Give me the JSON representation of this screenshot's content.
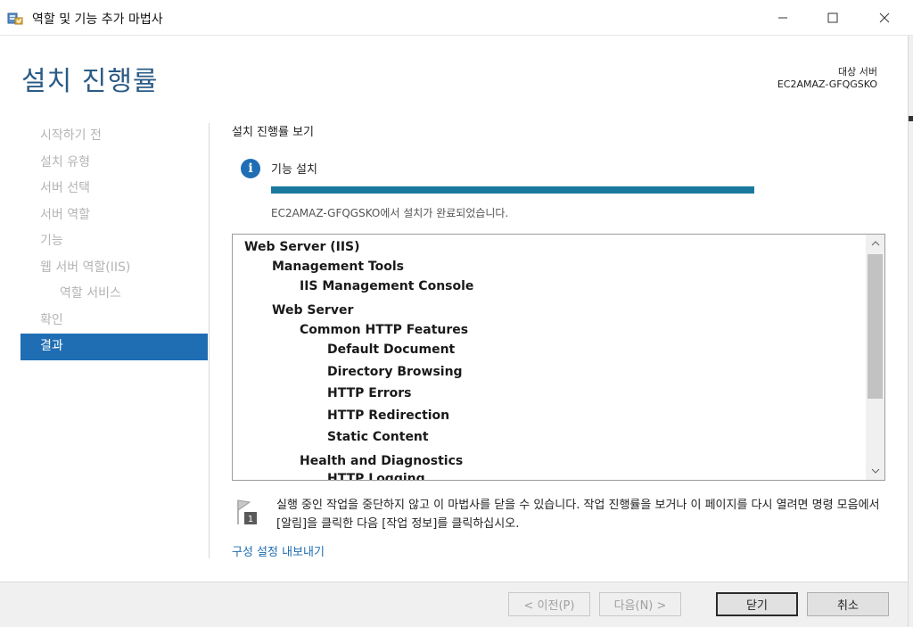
{
  "window": {
    "title": "역할 및 기능 추가 마법사",
    "icon": "server-manager-icon"
  },
  "header": {
    "page_title": "설치 진행률",
    "target_label": "대상 서버",
    "target_name": "EC2AMAZ-GFQGSKO"
  },
  "nav": {
    "items": [
      {
        "label": "시작하기 전",
        "state": "disabled"
      },
      {
        "label": "설치 유형",
        "state": "disabled"
      },
      {
        "label": "서버 선택",
        "state": "disabled"
      },
      {
        "label": "서버 역할",
        "state": "disabled"
      },
      {
        "label": "기능",
        "state": "disabled"
      },
      {
        "label": "웹 서버 역할(IIS)",
        "state": "disabled"
      },
      {
        "label": "역할 서비스",
        "state": "disabled"
      },
      {
        "label": "확인",
        "state": "disabled"
      },
      {
        "label": "결과",
        "state": "active"
      }
    ]
  },
  "main": {
    "section_title": "설치 진행률 보기",
    "feature_label": "기능 설치",
    "progress_percent": 100,
    "status_text": "EC2AMAZ-GFQGSKO에서 설치가 완료되었습니다.",
    "results": [
      {
        "label": "Web Server (IIS)",
        "level": 0
      },
      {
        "label": "Management Tools",
        "level": 1
      },
      {
        "label": "IIS Management Console",
        "level": 2
      },
      {
        "label": "Web Server",
        "level": 1
      },
      {
        "label": "Common HTTP Features",
        "level": 2
      },
      {
        "label": "Default Document",
        "level": 3
      },
      {
        "label": "Directory Browsing",
        "level": 3
      },
      {
        "label": "HTTP Errors",
        "level": 3
      },
      {
        "label": "HTTP Redirection",
        "level": 3
      },
      {
        "label": "Static Content",
        "level": 3
      },
      {
        "label": "Health and Diagnostics",
        "level": 2
      },
      {
        "label": "HTTP Logging",
        "level": 3
      }
    ],
    "note": "실행 중인 작업을 중단하지 않고 이 마법사를 닫을 수 있습니다. 작업 진행률을 보거나 이 페이지를 다시 열려면 명령 모음에서 [알림]을 클릭한 다음 [작업 정보]를 클릭하십시오.",
    "export_link": "구성 설정 내보내기"
  },
  "footer": {
    "prev_label": "< 이전(P)",
    "next_label": "다음(N) >",
    "close_label": "닫기",
    "cancel_label": "취소"
  },
  "colors": {
    "accent": "#1f6db3",
    "progress": "#1a7a9e",
    "title": "#2a5b86"
  }
}
